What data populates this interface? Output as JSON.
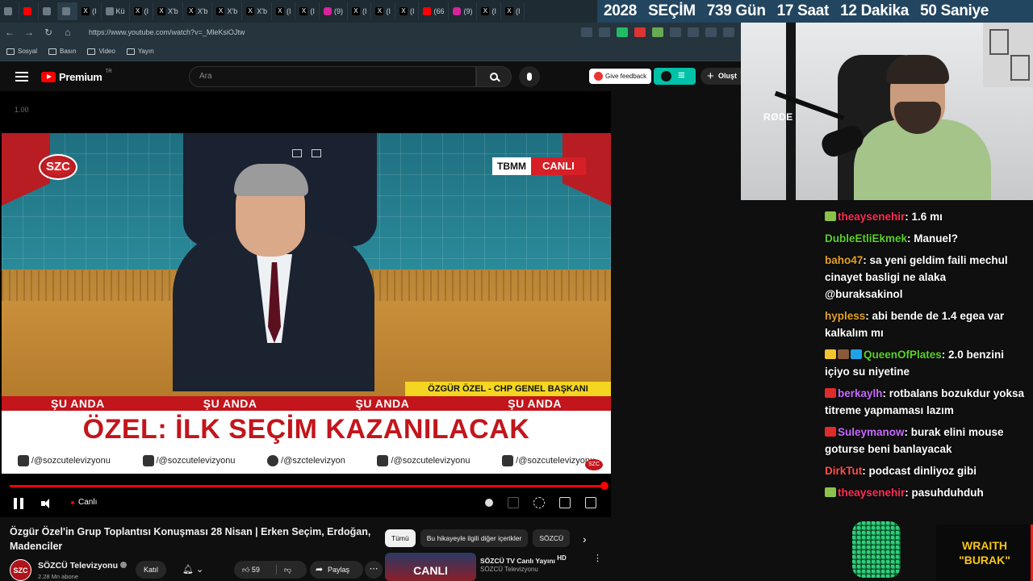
{
  "browser": {
    "tabs": [
      {
        "label": "",
        "icon": "window-icon"
      },
      {
        "label": "",
        "icon": "youtube-icon"
      },
      {
        "label": "",
        "icon": "audio-icon"
      },
      {
        "label": "",
        "icon": "audio-icon"
      },
      {
        "label": "(I",
        "icon": "x-icon"
      },
      {
        "label": "Kü",
        "icon": "generic-icon"
      },
      {
        "label": "(I",
        "icon": "x-icon"
      },
      {
        "label": "X'b",
        "icon": "x-icon"
      },
      {
        "label": "X'b",
        "icon": "x-icon"
      },
      {
        "label": "X'b",
        "icon": "x-icon"
      },
      {
        "label": "X'b",
        "icon": "x-icon"
      },
      {
        "label": "(I",
        "icon": "x-icon"
      },
      {
        "label": "(I",
        "icon": "x-icon"
      },
      {
        "label": "(9)",
        "icon": "instagram-icon"
      },
      {
        "label": "(I",
        "icon": "x-icon"
      },
      {
        "label": "(I",
        "icon": "x-icon"
      },
      {
        "label": "(I",
        "icon": "x-icon"
      },
      {
        "label": "(66",
        "icon": "youtube-icon"
      },
      {
        "label": "(9)",
        "icon": "instagram-icon"
      },
      {
        "label": "(I",
        "icon": "x-icon"
      },
      {
        "label": "(I",
        "icon": "x-icon"
      }
    ],
    "url": "https://www.youtube.com/watch?v=_MleKsiOJtw",
    "bookmarks": [
      "Sosyal",
      "Basın",
      "Video",
      "Yayın"
    ]
  },
  "timer": {
    "year": "2028",
    "label": "SEÇİM",
    "days": "739 Gün",
    "hours": "17 Saat",
    "minutes": "12 Dakika",
    "seconds": "50 Saniye"
  },
  "youtube": {
    "brand": "Premium",
    "region": "TR",
    "search_placeholder": "Ara",
    "feedback_label": "Give feedback",
    "create_label": "Oluşt",
    "speed_overlay": "1.00",
    "overlay": {
      "channel_logo": "SZC",
      "tbmm": "TBMM",
      "live_tag": "CANLI",
      "name_strip": "ÖZGÜR ÖZEL - CHP GENEL BAŞKANI",
      "su_anda": [
        "ŞU ANDA",
        "ŞU ANDA",
        "ŞU ANDA",
        "ŞU ANDA"
      ],
      "headline": "ÖZEL: İLK SEÇİM KAZANILACAK",
      "socials": [
        {
          "icon": "youtube-icon",
          "handle": "/@sozcutelevizyonu"
        },
        {
          "icon": "instagram-icon",
          "handle": "/@sozcutelevizyonu"
        },
        {
          "icon": "x-icon",
          "handle": "/@szctelevizyon"
        },
        {
          "icon": "tiktok-icon",
          "handle": "/@sozcutelevizyonu"
        },
        {
          "icon": "facebook-icon",
          "handle": "/@sozcutelevizyonu"
        }
      ],
      "mini_logo": "SZC"
    },
    "player": {
      "live_label": "Canlı",
      "progress": 1.0
    },
    "video": {
      "title": "Özgür Özel'in Grup Toplantısı Konuşması 28 Nisan | Erken Seçim, Erdoğan, Madenciler",
      "channel": "SÖZCÜ Televizyonu",
      "subscribers": "2.28 Mn abone",
      "avatar_text": "SZC",
      "join_label": "Katıl",
      "likes": "59",
      "share_label": "Paylaş"
    },
    "chips": [
      "Tümü",
      "Bu hikayeyle ilgili diğer içerikler",
      "SÖZCÜ"
    ],
    "recommendation": {
      "thumb_text": "CANLI",
      "title": "SÖZCÜ TV Canlı Yayını",
      "hd": "HD",
      "channel": "SÖZCÜ Televizyonu"
    }
  },
  "webcam": {
    "mic_brand": "RØDE"
  },
  "chat": [
    {
      "user": "theaysenehir",
      "color": "#ff2d55",
      "badges": [
        "sub"
      ],
      "text": "1.6 mı"
    },
    {
      "user": "DubleEtliEkmek",
      "color": "#5bd12a",
      "badges": [],
      "text": "Manuel?"
    },
    {
      "user": "baho47",
      "color": "#e5a126",
      "badges": [],
      "text": "sa yeni geldim faili mechul cinayet basligi ne alaka @buraksakinol"
    },
    {
      "user": "hypless",
      "color": "#e5a126",
      "badges": [],
      "text": "abi bende de 1.4 egea var kalkalım mı"
    },
    {
      "user": "QueenOfPlates",
      "color": "#5bd12a",
      "badges": [
        "crown",
        "brown",
        "blue"
      ],
      "text": "2.0 benzini içiyo su niyetine"
    },
    {
      "user": "berkaylh",
      "color": "#c86bff",
      "badges": [
        "red"
      ],
      "text": "rotbalans bozukdur yoksa titreme yapmaması lazım"
    },
    {
      "user": "Suleymanow",
      "color": "#c86bff",
      "badges": [
        "red"
      ],
      "text": "burak elini mouse goturse beni banlayacak"
    },
    {
      "user": "DirkTut",
      "color": "#ff4f4f",
      "badges": [],
      "text": "podcast dinliyoz gibi"
    },
    {
      "user": "theaysenehir",
      "color": "#ff2d55",
      "badges": [
        "sub"
      ],
      "text": "pasuhduhduh"
    }
  ],
  "overlay_badge": {
    "line1": "WRAITH",
    "line2": "\"BURAK\""
  }
}
